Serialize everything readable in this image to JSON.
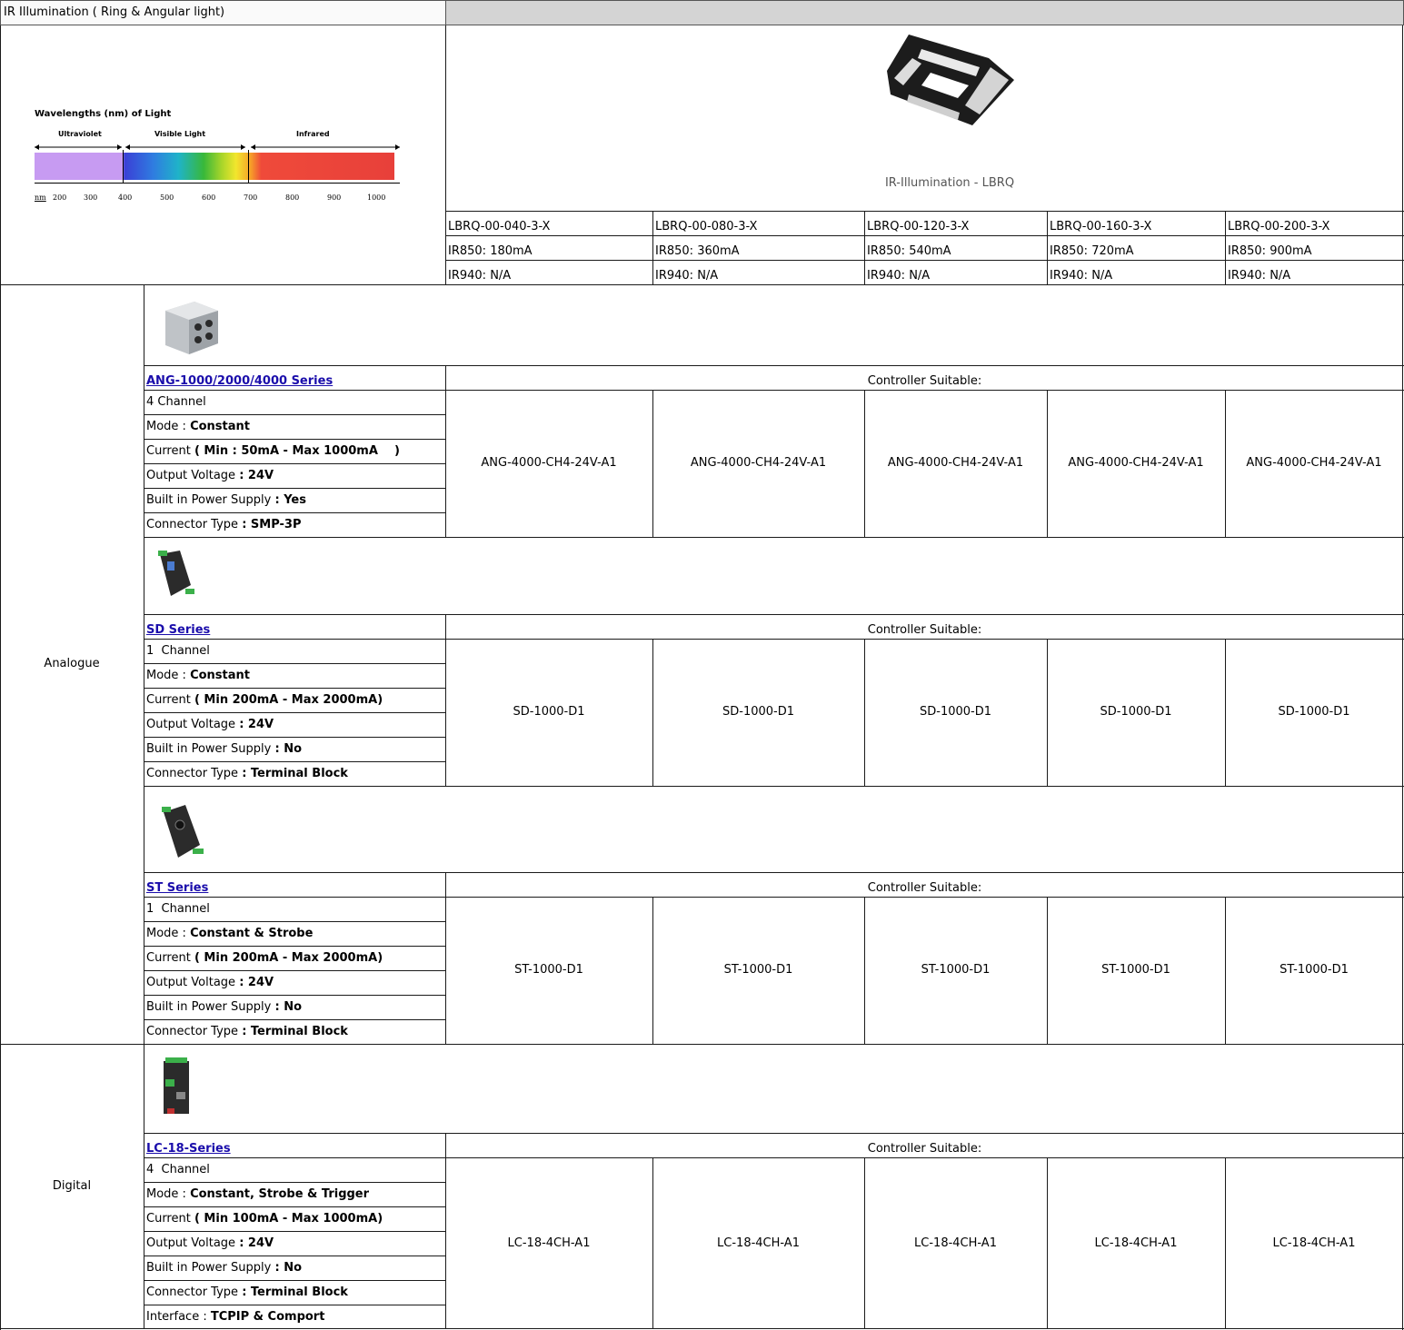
{
  "title": "IR Illumination ( Ring & Angular light)",
  "spectrum": {
    "heading": "Wavelengths (nm) of Light",
    "bands": [
      "Ultraviolet",
      "Visible Light",
      "Infrared"
    ],
    "unit": "nm",
    "ticks": [
      "200",
      "300",
      "400",
      "500",
      "600",
      "700",
      "800",
      "900",
      "1000"
    ]
  },
  "product": {
    "caption": "IR-Illumination - LBRQ",
    "models": [
      "LBRQ-00-040-3-X",
      "LBRQ-00-080-3-X",
      "LBRQ-00-120-3-X",
      "LBRQ-00-160-3-X",
      "LBRQ-00-200-3-X"
    ],
    "ir850": [
      "IR850: 180mA",
      "IR850: 360mA",
      "IR850: 540mA",
      "IR850: 720mA",
      "IR850: 900mA"
    ],
    "ir940": [
      "IR940: N/A",
      "IR940: N/A",
      "IR940: N/A",
      "IR940: N/A",
      "IR940: N/A"
    ]
  },
  "groups": {
    "analogue": "Analogue",
    "digital": "Digital"
  },
  "suitable_label": "Controller Suitable:",
  "controllers": [
    {
      "series": "ANG-1000/2000/4000 Series",
      "channel": "4 Channel",
      "mode_label": "Mode :",
      "mode": "Constant",
      "current_label": "Current",
      "current": "( Min : 50mA - Max 1000mA    )",
      "voltage_label": "Output Voltage",
      "voltage": ": 24V",
      "psu_label": "Built in Power Supply",
      "psu": ": Yes",
      "conn_label": "Connector Type",
      "conn": ": SMP-3P",
      "models": [
        "ANG-4000-CH4-24V-A1",
        "ANG-4000-CH4-24V-A1",
        "ANG-4000-CH4-24V-A1",
        "ANG-4000-CH4-24V-A1",
        "ANG-4000-CH4-24V-A1"
      ]
    },
    {
      "series": "SD Series",
      "channel": "1  Channel",
      "mode_label": "Mode :",
      "mode": "Constant",
      "current_label": "Current",
      "current": "( Min 200mA - Max 2000mA)",
      "voltage_label": "Output Voltage",
      "voltage": ": 24V",
      "psu_label": "Built in Power Supply",
      "psu": ": No",
      "conn_label": "Connector Type",
      "conn": ": Terminal Block",
      "models": [
        "SD-1000-D1",
        "SD-1000-D1",
        "SD-1000-D1",
        "SD-1000-D1",
        "SD-1000-D1"
      ]
    },
    {
      "series": "ST Series",
      "channel": "1  Channel",
      "mode_label": "Mode :",
      "mode": "Constant & Strobe",
      "current_label": "Current",
      "current": "( Min 200mA - Max 2000mA)",
      "voltage_label": "Output Voltage",
      "voltage": ": 24V",
      "psu_label": "Built in Power Supply",
      "psu": ": No",
      "conn_label": "Connector Type",
      "conn": ": Terminal Block",
      "models": [
        "ST-1000-D1",
        "ST-1000-D1",
        "ST-1000-D1",
        "ST-1000-D1",
        "ST-1000-D1"
      ]
    },
    {
      "series": "LC-18-Series",
      "channel": "4  Channel",
      "mode_label": "Mode :",
      "mode": "Constant, Strobe & Trigger",
      "current_label": "Current",
      "current": "( Min 100mA - Max 1000mA)",
      "voltage_label": "Output Voltage",
      "voltage": ": 24V",
      "psu_label": "Built in Power Supply",
      "psu": ": No",
      "conn_label": "Connector Type",
      "conn": ": Terminal Block",
      "iface_label": "Interface :",
      "iface": "TCPIP & Comport",
      "models": [
        "LC-18-4CH-A1",
        "LC-18-4CH-A1",
        "LC-18-4CH-A1",
        "LC-18-4CH-A1",
        "LC-18-4CH-A1"
      ]
    }
  ]
}
